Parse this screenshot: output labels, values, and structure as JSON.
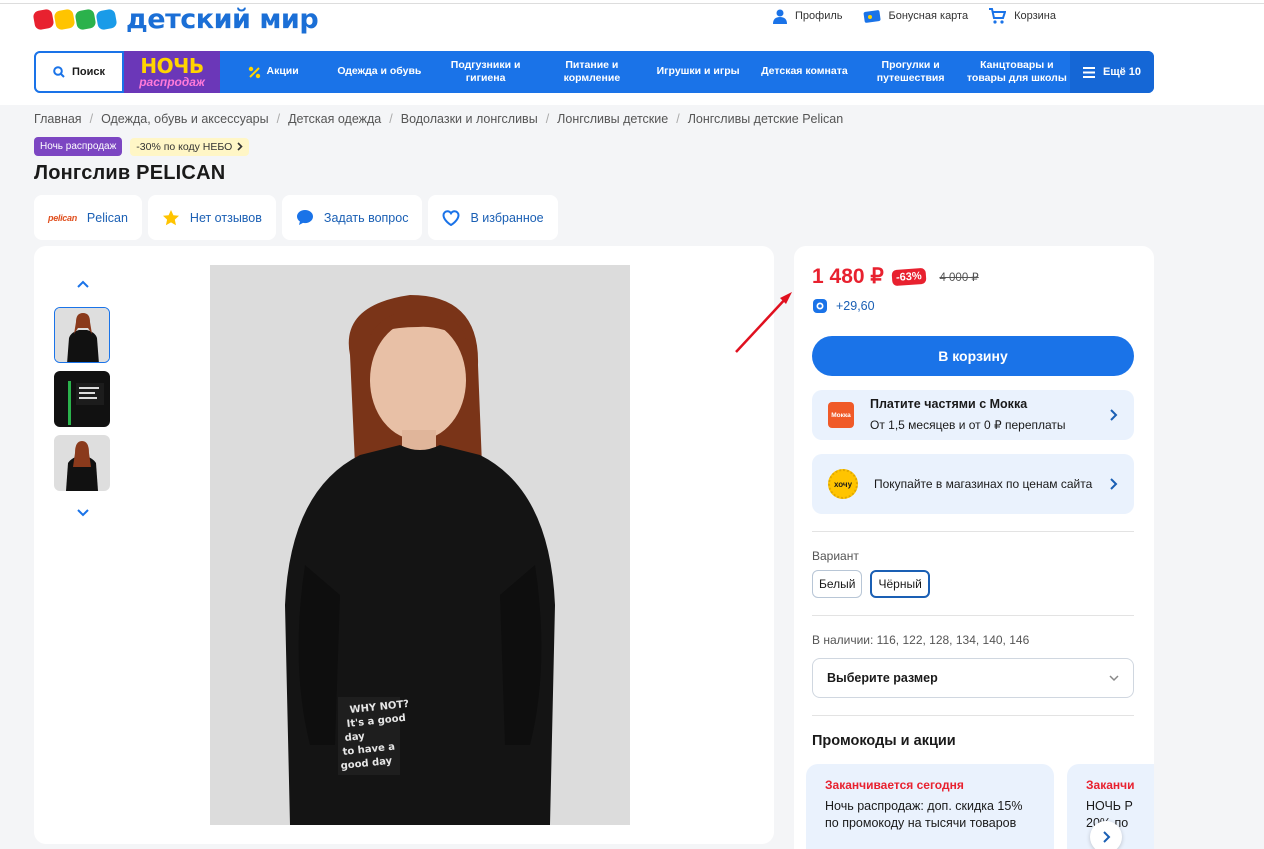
{
  "header": {
    "logo_text": "детский мир",
    "links": [
      {
        "label": "Профиль",
        "icon": "user-icon"
      },
      {
        "label": "Бонусная карта",
        "icon": "bonus-card-icon"
      },
      {
        "label": "Корзина",
        "icon": "cart-icon"
      }
    ]
  },
  "nav": {
    "search_label": "Поиск",
    "promo_line1": "НОЧЬ",
    "promo_line2": "распродаж",
    "items": [
      "Акции",
      "Одежда и обувь",
      "Подгузники и\nгигиена",
      "Питание и\nкормление",
      "Игрушки и игры",
      "Детская комната",
      "Прогулки и\nпутешествия",
      "Канцтовары и\nтовары для школы"
    ],
    "more_label": "Ещё 10"
  },
  "breadcrumbs": [
    "Главная",
    "Одежда, обувь и аксессуары",
    "Детская одежда",
    "Водолазки и лонгсливы",
    "Лонгсливы детские",
    "Лонгсливы детские Pelican"
  ],
  "badges": {
    "night": "Ночь распродаж",
    "code": "-30% по коду НЕБО"
  },
  "product": {
    "title": "Лонгслив PELICAN",
    "chips": {
      "brand_logo": "pelican",
      "brand": "Pelican",
      "reviews": "Нет отзывов",
      "ask": "Задать вопрос",
      "favorite": "В избранное"
    },
    "photo_print": [
      "WHY NOT?",
      "It's a good",
      "day",
      "to have a",
      "good day"
    ]
  },
  "buy": {
    "price": "1 480 ₽",
    "discount": "-63%",
    "old_price": "4 000 ₽",
    "bonus": "+29,60",
    "cart_button": "В корзину",
    "mokka_logo": "Мокка",
    "mokka_title": "Платите частями с Мокка",
    "mokka_text": "От 1,5 месяцев и от 0 ₽ переплаты",
    "hochu_logo": "хочу",
    "hochu_text": "Покупайте в магазинах по ценам сайта",
    "variant_label": "Вариант",
    "variants": [
      "Белый",
      "Чёрный"
    ],
    "availability": "В наличии: 116, 122, 128, 134, 140, 146",
    "size_placeholder": "Выберите размер",
    "promos_title": "Промокоды и акции",
    "promo1_tag": "Заканчивается сегодня",
    "promo1_text": "Ночь распродаж: доп. скидка 15% по промокоду на тысячи товаров",
    "promo2_tag": "Заканчи",
    "promo2_text": "НОЧЬ Р\n20% по"
  },
  "colors": {
    "brand_blue": "#1a73e8",
    "price_red": "#e8212f",
    "promo_purple": "#6b37b8"
  }
}
